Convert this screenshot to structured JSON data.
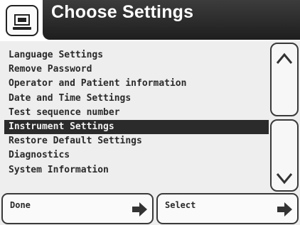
{
  "header": {
    "title": "Choose Settings",
    "icon": "settings-screen-icon"
  },
  "menu": {
    "items": [
      {
        "label": "Language Settings"
      },
      {
        "label": "Remove Password"
      },
      {
        "label": "Operator and Patient information"
      },
      {
        "label": "Date and Time Settings"
      },
      {
        "label": "Test sequence number"
      },
      {
        "label": "Instrument Settings",
        "selected": true
      },
      {
        "label": "Restore Default Settings"
      },
      {
        "label": "Diagnostics"
      },
      {
        "label": "System Information"
      }
    ]
  },
  "scroll": {
    "up_icon": "chevron-up-icon",
    "down_icon": "chevron-down-icon"
  },
  "buttons": {
    "done_label": "Done",
    "select_label": "Select",
    "arrow_icon": "arrow-right-icon"
  },
  "colors": {
    "header_bar": "#2b2b2b",
    "selected_bg": "#2b2b2b",
    "text": "#2a2a2a",
    "background": "#eeeeee"
  }
}
